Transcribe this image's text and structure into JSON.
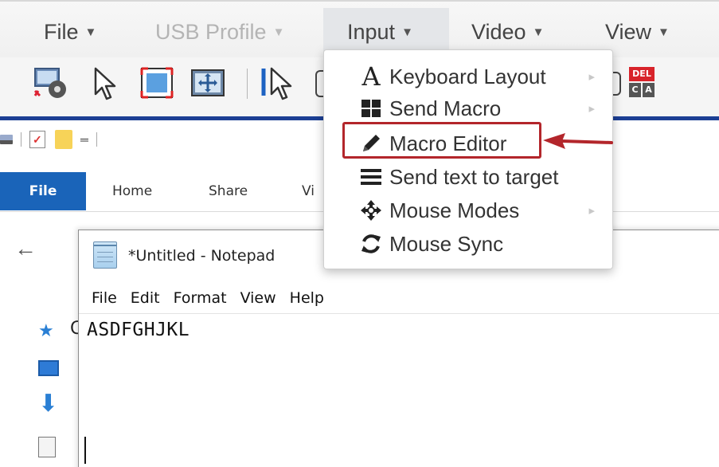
{
  "menubar": {
    "items": [
      {
        "label": "File",
        "state": "normal"
      },
      {
        "label": "USB Profile",
        "state": "disabled"
      },
      {
        "label": "Input",
        "state": "active"
      },
      {
        "label": "Video",
        "state": "normal"
      },
      {
        "label": "View",
        "state": "normal"
      }
    ]
  },
  "input_menu": {
    "items": [
      {
        "label": "Keyboard Layout",
        "icon": "letter-a-icon",
        "submenu": true
      },
      {
        "label": "Send Macro",
        "icon": "grid-icon",
        "submenu": true
      },
      {
        "label": "Macro Editor",
        "icon": "pencil-icon",
        "submenu": false,
        "highlighted": true
      },
      {
        "label": "Send text to target",
        "icon": "lines-icon",
        "submenu": false
      },
      {
        "label": "Mouse Modes",
        "icon": "move-icon",
        "submenu": true
      },
      {
        "label": "Mouse Sync",
        "icon": "sync-icon",
        "submenu": false
      }
    ],
    "icon_glyphs": {
      "letter_a": "A"
    },
    "submenu_glyph": "▸"
  },
  "toolbar": {
    "del_badge": "DEL",
    "ctrl_key": "C",
    "alt_key": "A"
  },
  "explorer": {
    "tabs": [
      "File",
      "Home",
      "Share",
      "Vi"
    ],
    "back_glyph": "←",
    "quick_access_partial": "C"
  },
  "notepad": {
    "title": "*Untitled - Notepad",
    "menu": [
      "File",
      "Edit",
      "Format",
      "View",
      "Help"
    ],
    "content": "ASDFGHJKL"
  },
  "colors": {
    "accent_blue": "#1c3f94",
    "ribbon_file_blue": "#1a64b9",
    "annotation_red": "#b3262b"
  }
}
